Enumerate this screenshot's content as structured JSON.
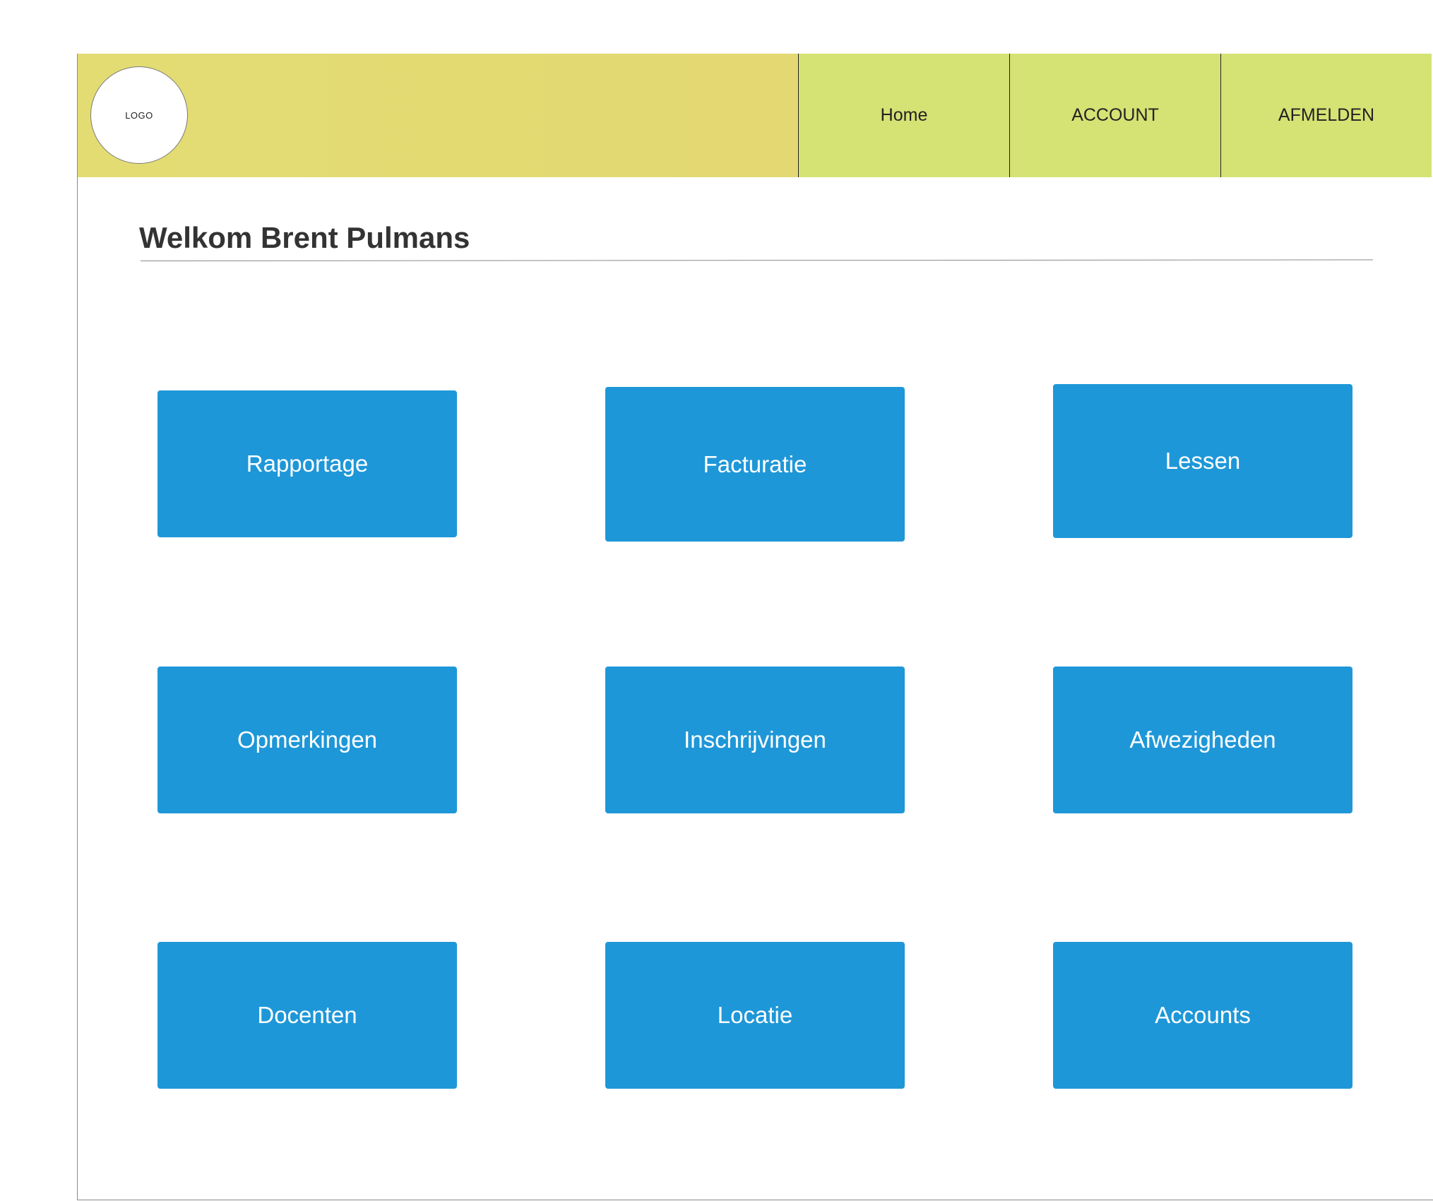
{
  "header": {
    "logo_text": "LOGO",
    "nav": {
      "home": "Home",
      "account": "ACCOUNT",
      "logout": "AFMELDEN"
    }
  },
  "main": {
    "welcome": "Welkom Brent Pulmans",
    "tiles": [
      "Rapportage",
      "Facturatie",
      "Lessen",
      "Opmerkingen",
      "Inschrijvingen",
      "Afwezigheden",
      "Docenten",
      "Locatie",
      "Accounts"
    ]
  },
  "colors": {
    "brand_bar": "#e3da72",
    "nav_bg": "#d5e274",
    "tile_bg": "#1e97d8",
    "heading_text": "#333333"
  }
}
